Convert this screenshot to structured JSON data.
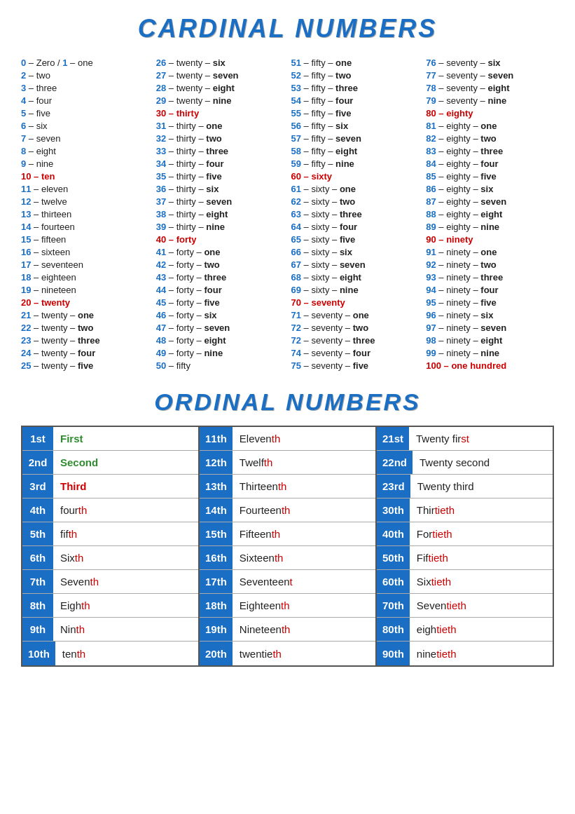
{
  "titles": {
    "cardinal": "CARDINAL NUMBERS",
    "ordinal": "ORDINAL NUMBERS"
  },
  "cardinals": {
    "col1": [
      {
        "num": "0",
        "text": "– Zero / ",
        "num2": "1",
        "text2": "– one"
      },
      {
        "num": "2",
        "text": "– two"
      },
      {
        "num": "3",
        "text": "– three"
      },
      {
        "num": "4",
        "text": "– four"
      },
      {
        "num": "5",
        "text": "– five"
      },
      {
        "num": "6",
        "text": "– six"
      },
      {
        "num": "7",
        "text": "– seven"
      },
      {
        "num": "8",
        "text": "– eight"
      },
      {
        "num": "9",
        "text": "– nine"
      },
      {
        "num": "10",
        "text": "– ten",
        "special": true
      },
      {
        "num": "11",
        "text": "– eleven"
      },
      {
        "num": "12",
        "text": "– twelve"
      },
      {
        "num": "13",
        "text": "– thirteen"
      },
      {
        "num": "14",
        "text": "– fourteen"
      },
      {
        "num": "15",
        "text": "– fifteen"
      },
      {
        "num": "16",
        "text": "– sixteen"
      },
      {
        "num": "17",
        "text": "– seventeen"
      },
      {
        "num": "18",
        "text": "– eighteen"
      },
      {
        "num": "19",
        "text": "– nineteen"
      },
      {
        "num": "20",
        "text": "– twenty",
        "special": true
      },
      {
        "num": "21",
        "text": "– twenty – ",
        "bold": "one"
      },
      {
        "num": "22",
        "text": "– twenty – ",
        "bold": "two"
      },
      {
        "num": "23",
        "text": "– twenty – ",
        "bold": "three"
      },
      {
        "num": "24",
        "text": "– twenty – ",
        "bold": "four"
      },
      {
        "num": "25",
        "text": "– twenty – ",
        "bold": "five"
      }
    ],
    "col2": [
      {
        "num": "26",
        "text": "– twenty – ",
        "bold": "six"
      },
      {
        "num": "27",
        "text": "– twenty – ",
        "bold": "seven"
      },
      {
        "num": "28",
        "text": "– twenty – ",
        "bold": "eight"
      },
      {
        "num": "29",
        "text": "– twenty – ",
        "bold": "nine"
      },
      {
        "num": "30",
        "text": "– thirty",
        "special": true
      },
      {
        "num": "31",
        "text": "– thirty – ",
        "bold": "one"
      },
      {
        "num": "32",
        "text": "– thirty – ",
        "bold": "two"
      },
      {
        "num": "33",
        "text": "– thirty – ",
        "bold": "three"
      },
      {
        "num": "34",
        "text": "– thirty – ",
        "bold": "four"
      },
      {
        "num": "35",
        "text": "– thirty – ",
        "bold": "five"
      },
      {
        "num": "36",
        "text": "– thirty – ",
        "bold": "six"
      },
      {
        "num": "37",
        "text": "– thirty – ",
        "bold": "seven"
      },
      {
        "num": "38",
        "text": "– thirty – ",
        "bold": "eight"
      },
      {
        "num": "39",
        "text": "– thirty – ",
        "bold": "nine"
      },
      {
        "num": "40",
        "text": "– forty",
        "special": true
      },
      {
        "num": "41",
        "text": "– forty – ",
        "bold": "one"
      },
      {
        "num": "42",
        "text": "– forty – ",
        "bold": "two"
      },
      {
        "num": "43",
        "text": "– forty – ",
        "bold": "three"
      },
      {
        "num": "44",
        "text": "– forty – ",
        "bold": "four"
      },
      {
        "num": "45",
        "text": "– forty – ",
        "bold": "five"
      },
      {
        "num": "46",
        "text": "– forty – ",
        "bold": "six"
      },
      {
        "num": "47",
        "text": "– forty – ",
        "bold": "seven"
      },
      {
        "num": "48",
        "text": "– forty – ",
        "bold": "eight"
      },
      {
        "num": "49",
        "text": "– forty – ",
        "bold": "nine"
      },
      {
        "num": "50",
        "text": "– fifty"
      }
    ],
    "col3": [
      {
        "num": "51",
        "text": "– fifty – ",
        "bold": "one"
      },
      {
        "num": "52",
        "text": "– fifty – ",
        "bold": "two"
      },
      {
        "num": "53",
        "text": "– fifty – ",
        "bold": "three"
      },
      {
        "num": "54",
        "text": "– fifty – ",
        "bold": "four"
      },
      {
        "num": "55",
        "text": "– fifty – ",
        "bold": "five"
      },
      {
        "num": "56",
        "text": "– fifty – ",
        "bold": "six"
      },
      {
        "num": "57",
        "text": "– fifty – ",
        "bold": "seven"
      },
      {
        "num": "58",
        "text": "– fifty – ",
        "bold": "eight"
      },
      {
        "num": "59",
        "text": "– fifty – ",
        "bold": "nine"
      },
      {
        "num": "60",
        "text": "– sixty",
        "special": true
      },
      {
        "num": "61",
        "text": "– sixty – ",
        "bold": "one"
      },
      {
        "num": "62",
        "text": "– sixty – ",
        "bold": "two"
      },
      {
        "num": "63",
        "text": "– sixty – ",
        "bold": "three"
      },
      {
        "num": "64",
        "text": "– sixty – ",
        "bold": "four"
      },
      {
        "num": "65",
        "text": "– sixty – ",
        "bold": "five"
      },
      {
        "num": "66",
        "text": "– sixty – ",
        "bold": "six"
      },
      {
        "num": "67",
        "text": "– sixty – ",
        "bold": "seven"
      },
      {
        "num": "68",
        "text": "– sixty – ",
        "bold": "eight"
      },
      {
        "num": "69",
        "text": "– sixty – ",
        "bold": "nine"
      },
      {
        "num": "70",
        "text": "– seventy",
        "special": true
      },
      {
        "num": "71",
        "text": "– seventy – ",
        "bold": "one"
      },
      {
        "num": "72",
        "text": "– seventy – ",
        "bold": "two"
      },
      {
        "num": "72",
        "text": "– seventy – ",
        "bold": "three"
      },
      {
        "num": "74",
        "text": "– seventy – ",
        "bold": "four"
      },
      {
        "num": "75",
        "text": "– seventy – ",
        "bold": "five"
      }
    ],
    "col4": [
      {
        "num": "76",
        "text": "– seventy – ",
        "bold": "six"
      },
      {
        "num": "77",
        "text": "– seventy – ",
        "bold": "seven"
      },
      {
        "num": "78",
        "text": "– seventy – ",
        "bold": "eight"
      },
      {
        "num": "79",
        "text": "– seventy – ",
        "bold": "nine"
      },
      {
        "num": "80",
        "text": "– eighty",
        "special": true
      },
      {
        "num": "81",
        "text": "– eighty – ",
        "bold": "one"
      },
      {
        "num": "82",
        "text": "– eighty – ",
        "bold": "two"
      },
      {
        "num": "83",
        "text": "– eighty – ",
        "bold": "three"
      },
      {
        "num": "84",
        "text": "– eighty – ",
        "bold": "four"
      },
      {
        "num": "85",
        "text": "– eighty – ",
        "bold": "five"
      },
      {
        "num": "86",
        "text": "– eighty – ",
        "bold": "six"
      },
      {
        "num": "87",
        "text": "– eighty – ",
        "bold": "seven"
      },
      {
        "num": "88",
        "text": "– eighty – ",
        "bold": "eight"
      },
      {
        "num": "89",
        "text": "– eighty – ",
        "bold": "nine"
      },
      {
        "num": "90",
        "text": "– ninety",
        "special": true
      },
      {
        "num": "91",
        "text": "– ninety – ",
        "bold": "one"
      },
      {
        "num": "92",
        "text": "– ninety – ",
        "bold": "two"
      },
      {
        "num": "93",
        "text": "– ninety – ",
        "bold": "three"
      },
      {
        "num": "94",
        "text": "– ninety – ",
        "bold": "four"
      },
      {
        "num": "95",
        "text": "– ninety – ",
        "bold": "five"
      },
      {
        "num": "96",
        "text": "– ninety – ",
        "bold": "six"
      },
      {
        "num": "97",
        "text": "– ninety – ",
        "bold": "seven"
      },
      {
        "num": "98",
        "text": "– ninety – ",
        "bold": "eight"
      },
      {
        "num": "99",
        "text": "– ninety – ",
        "bold": "nine"
      },
      {
        "num": "100",
        "text": "– one hundred",
        "special": true
      }
    ]
  },
  "ordinals": {
    "col1": [
      {
        "num": "1st",
        "word": "First",
        "style": "green"
      },
      {
        "num": "2nd",
        "word": "Second",
        "style": "green"
      },
      {
        "num": "3rd",
        "word": "Third",
        "style": "red"
      },
      {
        "num": "4th",
        "word": "four",
        "suffix": "th"
      },
      {
        "num": "5th",
        "word": "fif",
        "suffix": "th"
      },
      {
        "num": "6th",
        "word": "Six",
        "suffix": "th"
      },
      {
        "num": "7th",
        "word": "Seven",
        "suffix": "th"
      },
      {
        "num": "8th",
        "word": "Eigh",
        "suffix": "th"
      },
      {
        "num": "9th",
        "word": "Nin",
        "suffix": "th"
      },
      {
        "num": "10th",
        "word": "ten",
        "suffix": "th"
      }
    ],
    "col2": [
      {
        "num": "11th",
        "word": "Eleven",
        "suffix": "th"
      },
      {
        "num": "12th",
        "word": "Twelf",
        "suffix": "th"
      },
      {
        "num": "13th",
        "word": "Thirteen",
        "suffix": "th"
      },
      {
        "num": "14th",
        "word": "Fourteen",
        "suffix": "th"
      },
      {
        "num": "15th",
        "word": "Fifteen",
        "suffix": "th"
      },
      {
        "num": "16th",
        "word": "Sixteen",
        "suffix": "th"
      },
      {
        "num": "17th",
        "word": "Seventeen",
        "suffix": "t"
      },
      {
        "num": "18th",
        "word": "Eighteen",
        "suffix": "th"
      },
      {
        "num": "19th",
        "word": "Nineteen",
        "suffix": "th"
      },
      {
        "num": "20th",
        "word": "twentie",
        "suffix": "th"
      }
    ],
    "col3": [
      {
        "num": "21st",
        "word": "Twenty fir",
        "suffix": "st"
      },
      {
        "num": "22nd",
        "word": "Twenty second",
        "suffix": ""
      },
      {
        "num": "23rd",
        "word": "Twenty third",
        "suffix": ""
      },
      {
        "num": "30th",
        "word": "Thir",
        "suffix": "tieth"
      },
      {
        "num": "40th",
        "word": "For",
        "suffix": "tieth"
      },
      {
        "num": "50th",
        "word": "Fif",
        "suffix": "tieth"
      },
      {
        "num": "60th",
        "word": "Six",
        "suffix": "tieth"
      },
      {
        "num": "70th",
        "word": "Seven",
        "suffix": "tieth"
      },
      {
        "num": "80th",
        "word": "eigh",
        "suffix": "tieth"
      },
      {
        "num": "90th",
        "word": "nine",
        "suffix": "tieth"
      }
    ]
  }
}
